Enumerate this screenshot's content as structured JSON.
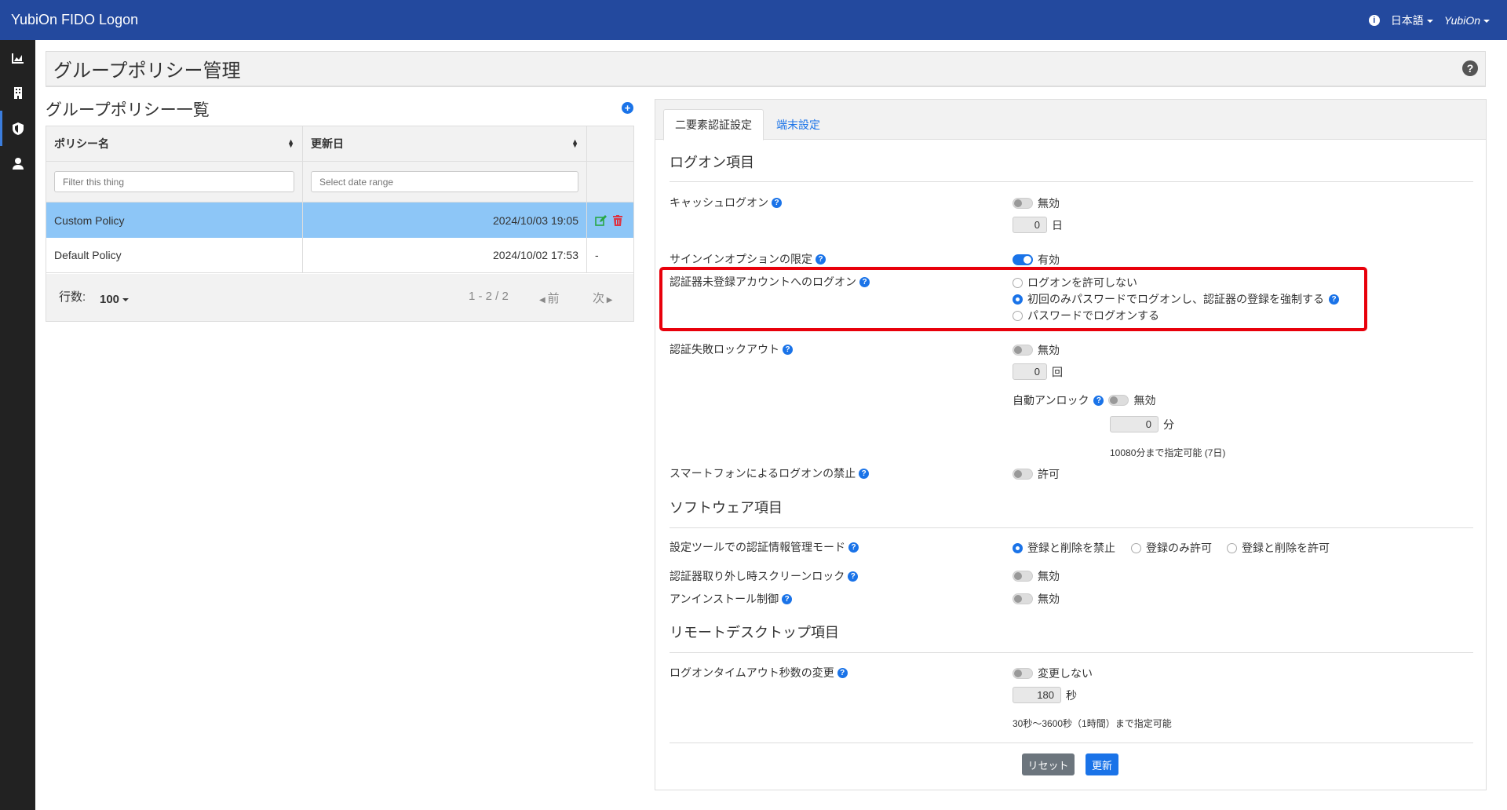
{
  "topbar": {
    "brand": "YubiOn FIDO Logon",
    "language": "日本語",
    "user": "YubiOn"
  },
  "sidebar": {
    "items": [
      "chart-icon",
      "building-icon",
      "shield-icon",
      "user-icon"
    ]
  },
  "page": {
    "title": "グループポリシー管理"
  },
  "policy_list": {
    "title": "グループポリシー一覧",
    "columns": [
      "ポリシー名",
      "更新日"
    ],
    "filter_placeholder": "Filter this thing",
    "date_placeholder": "Select date range",
    "rows": [
      {
        "name": "Custom Policy",
        "updated": "2024/10/03 19:05",
        "selected": true
      },
      {
        "name": "Default Policy",
        "updated": "2024/10/02 17:53",
        "action": "-"
      }
    ],
    "pager": {
      "rows_label": "行数:",
      "rows_value": "100",
      "range": "1 - 2 / 2",
      "prev": "前",
      "next": "次"
    }
  },
  "tabs": [
    {
      "label": "二要素認証設定",
      "active": true
    },
    {
      "label": "端末設定",
      "active": false
    }
  ],
  "sections": {
    "logon": "ログオン項目",
    "software": "ソフトウェア項目",
    "remote": "リモートデスクトップ項目"
  },
  "settings": {
    "cache_logon": {
      "label": "キャッシュログオン",
      "toggle": "無効",
      "enabled": false,
      "days": "0",
      "unit": "日"
    },
    "signin_option": {
      "label": "サインインオプションの限定",
      "toggle": "有効",
      "enabled": true
    },
    "unregistered": {
      "label": "認証器未登録アカウントへのログオン",
      "options": [
        "ログオンを許可しない",
        "初回のみパスワードでログオンし、認証器の登録を強制する",
        "パスワードでログオンする"
      ],
      "selected": 1
    },
    "lockout": {
      "label": "認証失敗ロックアウト",
      "toggle": "無効",
      "enabled": false,
      "count": "0",
      "unit": "回",
      "auto_unlock_label": "自動アンロック",
      "auto_unlock_toggle": "無効",
      "minutes": "0",
      "minutes_unit": "分",
      "note": "10080分まで指定可能 (7日)"
    },
    "smartphone": {
      "label": "スマートフォンによるログオンの禁止",
      "toggle": "許可",
      "enabled": false
    },
    "cred_mode": {
      "label": "設定ツールでの認証情報管理モード",
      "options": [
        "登録と削除を禁止",
        "登録のみ許可",
        "登録と削除を許可"
      ],
      "selected": 0
    },
    "screen_lock": {
      "label": "認証器取り外し時スクリーンロック",
      "toggle": "無効",
      "enabled": false
    },
    "uninstall": {
      "label": "アンインストール制御",
      "toggle": "無効",
      "enabled": false
    },
    "timeout": {
      "label": "ログオンタイムアウト秒数の変更",
      "toggle": "変更しない",
      "enabled": false,
      "seconds": "180",
      "unit": "秒",
      "note": "30秒～3600秒（1時間）まで指定可能"
    }
  },
  "buttons": {
    "reset": "リセット",
    "update": "更新"
  },
  "colors": {
    "topbar": "#23499e",
    "accent": "#1a73e8",
    "highlight": "#e8000b",
    "selected_row": "#8dc6f7"
  }
}
